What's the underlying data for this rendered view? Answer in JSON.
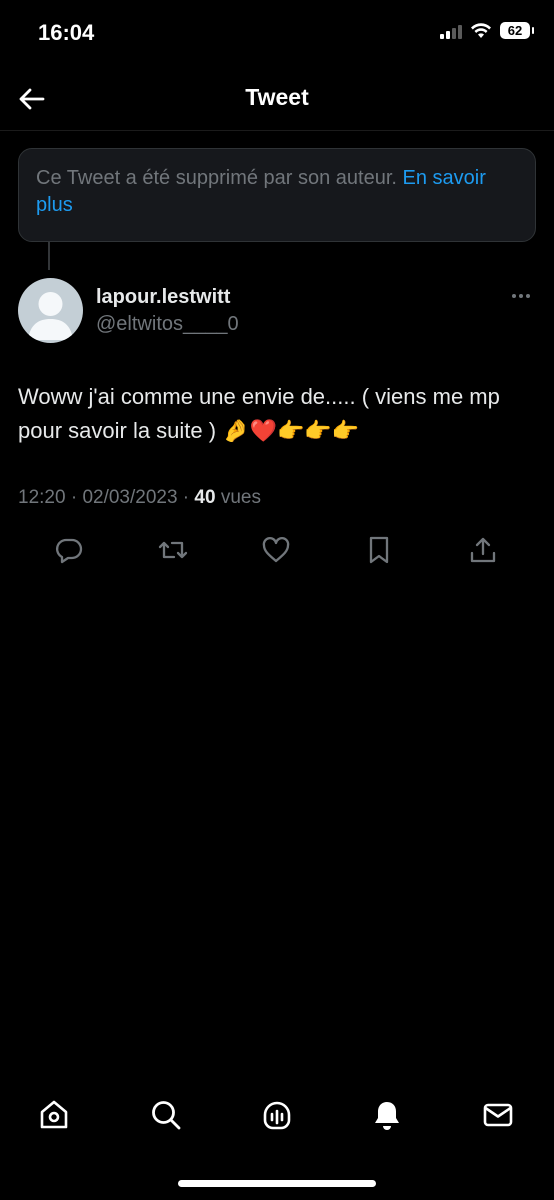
{
  "status_bar": {
    "time": "16:04",
    "battery": "62"
  },
  "header": {
    "title": "Tweet"
  },
  "deleted_notice": {
    "text": "Ce Tweet a été supprimé par son auteur. ",
    "link": "En savoir plus"
  },
  "tweet": {
    "author_name": "lapour.lestwitt",
    "author_handle": "@eltwitos____0",
    "text": "Woww j'ai comme une envie de..... ( viens me mp pour savoir la suite ) 🤌❤️👉👉👉",
    "time": "12:20",
    "date": "02/03/2023",
    "separator": " · ",
    "views_count": "40",
    "views_label": " vues"
  },
  "actions": [
    "reply-icon",
    "retweet-icon",
    "like-icon",
    "bookmark-icon",
    "share-icon"
  ],
  "bottom_nav": [
    "home-icon",
    "search-icon",
    "spaces-icon",
    "notifications-icon",
    "messages-icon"
  ],
  "colors": {
    "background": "#000000",
    "accent": "#1d9bf0",
    "muted": "#71767b",
    "text": "#e7e9ea"
  }
}
